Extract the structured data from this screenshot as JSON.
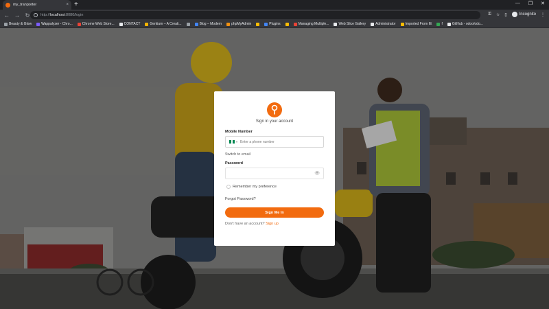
{
  "browser": {
    "tab_title": "my_tranporter",
    "tab_close": "×",
    "new_tab": "+",
    "url_host": "localhost",
    "url_full_prefix": "http://",
    "url_path": ":8080/login",
    "incognito_label": "Incognito",
    "window_controls": [
      "—",
      "❐",
      "✕"
    ]
  },
  "bookmarks": [
    {
      "label": "Beauty & Glow",
      "color": "#9aa0a6"
    },
    {
      "label": "Wappalyzer - Chro...",
      "color": "#7c5cff"
    },
    {
      "label": "Chrome Web Store...",
      "color": "#e94235"
    },
    {
      "label": "CONTACT",
      "color": "#e8eaed"
    },
    {
      "label": "Gentium – A Creati...",
      "color": "#f4b400"
    },
    {
      "label": "",
      "color": "#9aa0a6"
    },
    {
      "label": "Blog – Modern",
      "color": "#4285f4"
    },
    {
      "label": "phpMyAdmin",
      "color": "#f29111"
    },
    {
      "label": "",
      "color": "#fbbc04"
    },
    {
      "label": "Plugins",
      "color": "#4285f4"
    },
    {
      "label": "",
      "color": "#fbbc04"
    },
    {
      "label": "Managing Multiple...",
      "color": "#e94235"
    },
    {
      "label": "Web Slice Gallery",
      "color": "#e8eaed"
    },
    {
      "label": "Administrator",
      "color": "#e8eaed"
    },
    {
      "label": "Imported From IE",
      "color": "#fbbc04"
    },
    {
      "label": "f",
      "color": "#34a853"
    },
    {
      "label": "GitHub - odoo/odo...",
      "color": "#e8eaed"
    }
  ],
  "login": {
    "subtitle": "Sign in your account",
    "mobile_label": "Mobile Number",
    "phone_placeholder": "Enter a phone number",
    "switch_to_email": "Switch to email",
    "password_label": "Password",
    "remember_label": "Remember my preference",
    "forgot_password": "Forgot Password?",
    "sign_in_button": "Sign Me In",
    "no_account_text": "Don't have an account?",
    "sign_up_link": "Sign up"
  },
  "colors": {
    "accent": "#f26b0f",
    "flag_green": "#008751",
    "flag_white": "#ffffff"
  }
}
